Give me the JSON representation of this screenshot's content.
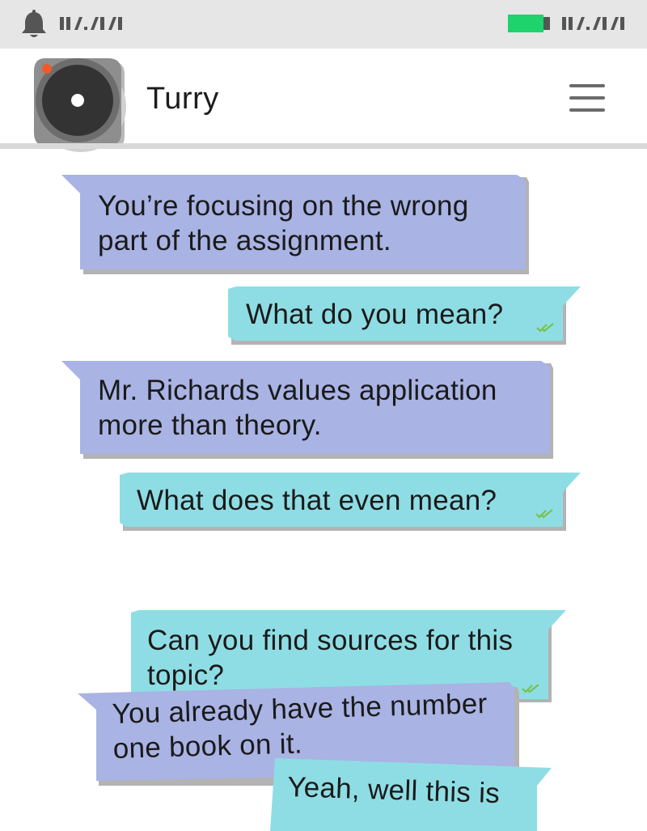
{
  "status_bar": {
    "left_text": "▮▮/▮/▮▮",
    "right_text": "▮▮/▮/▮▮",
    "battery_color": "#1ed36c",
    "icons": [
      "bell-icon",
      "battery-icon"
    ]
  },
  "header": {
    "contact_name": "Turry",
    "avatar_icon": "camera-lens-avatar",
    "menu_icon": "hamburger-menu-icon"
  },
  "colors": {
    "received_bubble": "#a9b3e4",
    "sent_bubble": "#8fdde4",
    "read_ticks": "#77c24a"
  },
  "messages": [
    {
      "direction": "received",
      "lines": [
        "You’re focusing on the wrong",
        "part of the assignment."
      ]
    },
    {
      "direction": "sent",
      "lines": [
        "What do you mean?"
      ],
      "status": "read"
    },
    {
      "direction": "received",
      "lines": [
        "Mr. Richards values application",
        "more than theory."
      ]
    },
    {
      "direction": "sent",
      "lines": [
        "What does that even mean?"
      ],
      "status": "read"
    },
    {
      "direction": "sent",
      "lines": [
        "Can you find sources for this",
        "topic?"
      ],
      "status": "read"
    },
    {
      "direction": "received",
      "lines": [
        "You already have the number",
        "one book on it."
      ]
    },
    {
      "direction": "sent",
      "lines": [
        "Yeah, well this is"
      ]
    }
  ]
}
